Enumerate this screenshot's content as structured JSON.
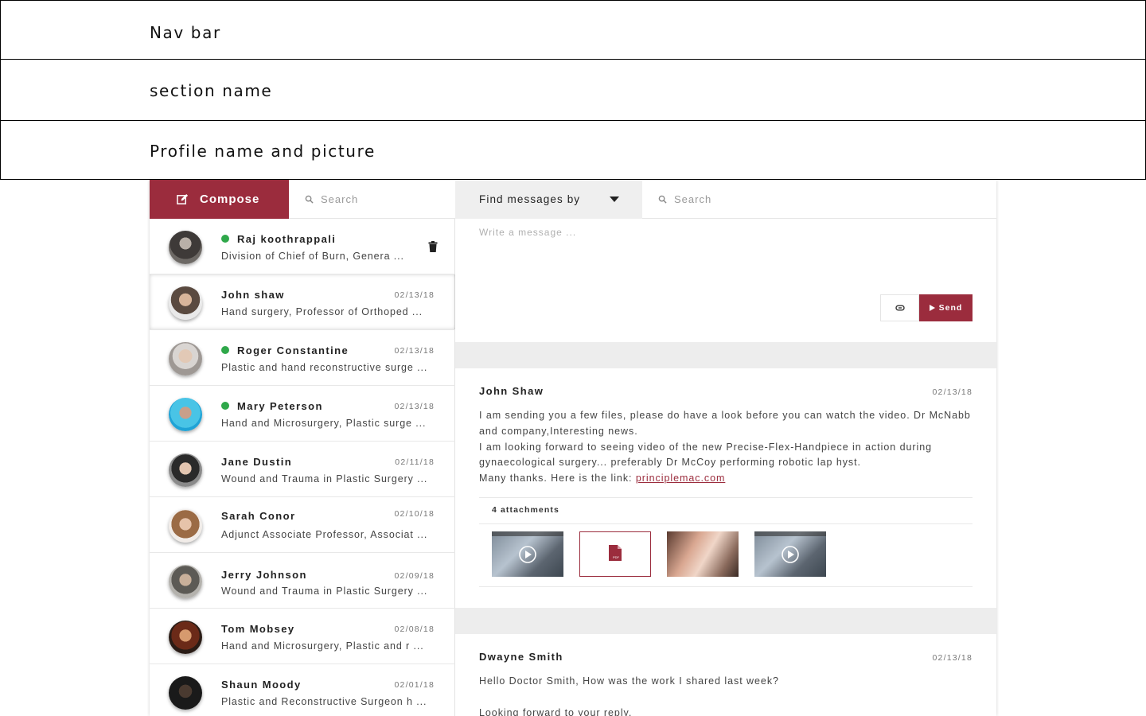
{
  "bands": {
    "nav": "Nav bar",
    "section": "section name",
    "profile": "Profile name and picture"
  },
  "toolbar": {
    "compose_label": "Compose",
    "contacts_search_placeholder": "Search",
    "find_label": "Find messages by",
    "messages_search_placeholder": "Search"
  },
  "contacts": [
    {
      "name": "Raj koothrappali",
      "desc": "Division of Chief of Burn, Genera ...",
      "date": "",
      "online": true
    },
    {
      "name": "John shaw",
      "desc": "Hand surgery, Professor of Orthoped ...",
      "date": "02/13/18",
      "online": false
    },
    {
      "name": "Roger Constantine",
      "desc": "Plastic and hand reconstructive surge ...",
      "date": "02/13/18",
      "online": true
    },
    {
      "name": "Mary Peterson",
      "desc": "Hand and Microsurgery, Plastic surge ...",
      "date": "02/13/18",
      "online": true
    },
    {
      "name": "Jane Dustin",
      "desc": "Wound and Trauma in Plastic Surgery ...",
      "date": "02/11/18",
      "online": false
    },
    {
      "name": "Sarah Conor",
      "desc": "Adjunct Associate Professor, Associat ...",
      "date": "02/10/18",
      "online": false
    },
    {
      "name": "Jerry Johnson",
      "desc": "Wound and Trauma in Plastic Surgery ...",
      "date": "02/09/18",
      "online": false
    },
    {
      "name": "Tom Mobsey",
      "desc": "Hand and Microsurgery, Plastic and r ...",
      "date": "02/08/18",
      "online": false
    },
    {
      "name": "Shaun Moody",
      "desc": "Plastic and Reconstructive Surgeon h ...",
      "date": "02/01/18",
      "online": false
    }
  ],
  "composer": {
    "placeholder": "Write a message ...",
    "send_label": "Send"
  },
  "messages": [
    {
      "from": "John Shaw",
      "date": "02/13/18",
      "line1": "I am sending you a few files, please do have a look before you can watch the video. Dr McNabb and company,Interesting news.",
      "line2": "I am looking forward to seeing video of the new Precise-Flex-Handpiece in action during gynaecological surgery... preferably Dr McCoy performing robotic lap hyst.",
      "line3": "Many thanks. Here is the link: ",
      "link": "principlemac.com",
      "attachments_label": "4 attachments",
      "attachments": [
        "video-thumbnail",
        "pdf-file",
        "image-thumbnail",
        "video-thumbnail"
      ],
      "pdf_label": "PDF"
    },
    {
      "from": "Dwayne Smith",
      "date": "02/13/18",
      "line1": "Hello Doctor Smith, How was the work I shared last week?",
      "line2": "Looking forward to your reply."
    }
  ],
  "colors": {
    "accent": "#9b2c3d",
    "online": "#2fa84a",
    "separator": "#ededed"
  }
}
